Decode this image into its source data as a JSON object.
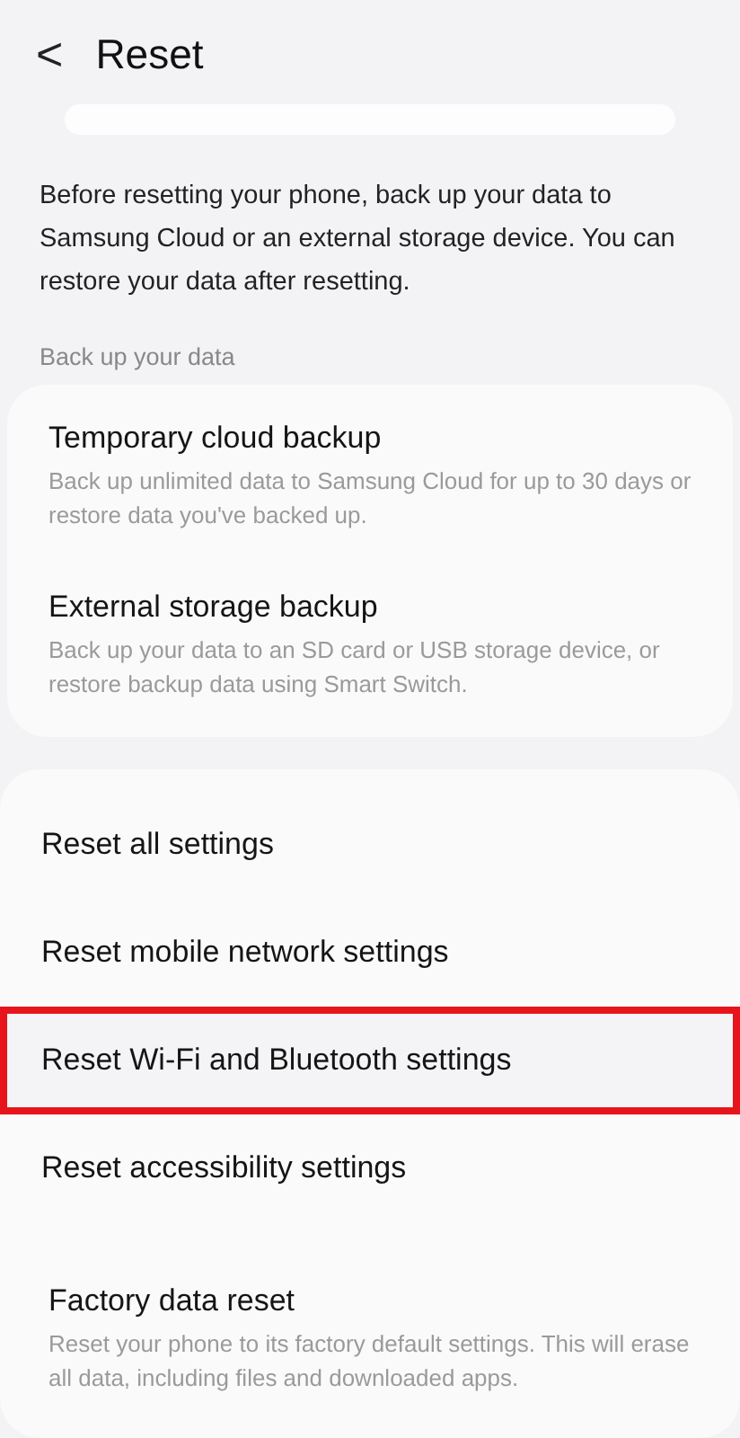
{
  "header": {
    "back": "<",
    "title": "Reset"
  },
  "intro": "Before resetting your phone, back up your data to Samsung Cloud or an external storage device. You can restore your data after resetting.",
  "backup_section": {
    "label": "Back up your data",
    "items": [
      {
        "title": "Temporary cloud backup",
        "subtitle": "Back up unlimited data to Samsung Cloud for up to 30 days or restore data you've backed up."
      },
      {
        "title": "External storage backup",
        "subtitle": "Back up your data to an SD card or USB storage device, or restore backup data using Smart Switch."
      }
    ]
  },
  "reset_items": [
    {
      "title": "Reset all settings",
      "highlighted": false
    },
    {
      "title": "Reset mobile network settings",
      "highlighted": false
    },
    {
      "title": "Reset Wi-Fi and Bluetooth settings",
      "highlighted": true
    },
    {
      "title": "Reset accessibility settings",
      "highlighted": false
    }
  ],
  "factory": {
    "title": "Factory data reset",
    "subtitle": "Reset your phone to its factory default settings. This will erase all data, including files and downloaded apps."
  }
}
